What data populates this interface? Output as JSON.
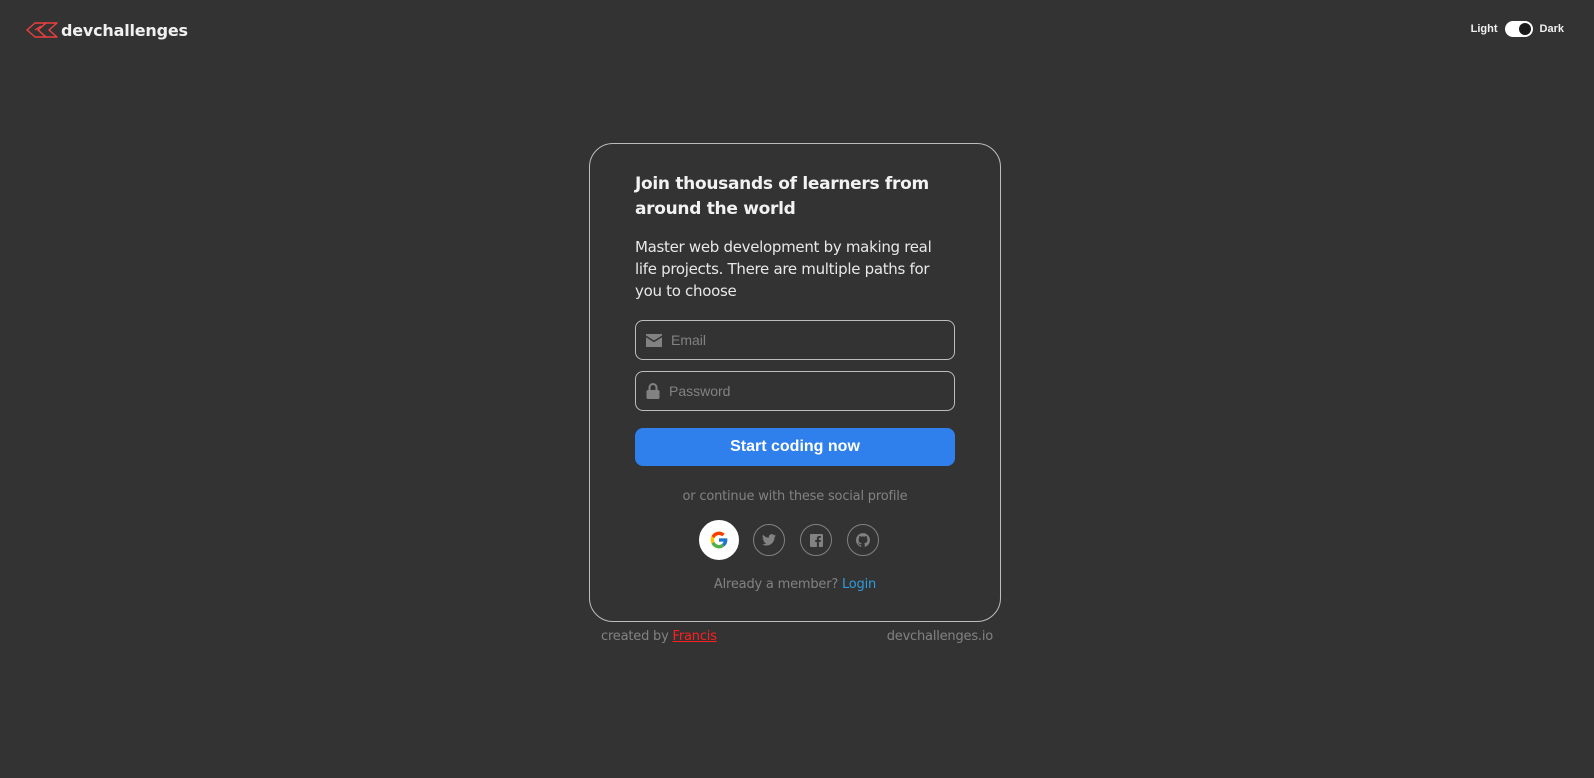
{
  "header": {
    "brand_name": "devchallenges",
    "logo_icon": "devchallenges-logo-icon",
    "theme": {
      "light_label": "Light",
      "dark_label": "Dark",
      "state": "dark"
    }
  },
  "card": {
    "headline": "Join thousands of learners from around the world",
    "subtitle": "Master web development by making real life projects. There are multiple paths for you to choose",
    "email": {
      "icon": "mail-icon",
      "placeholder": "Email",
      "value": ""
    },
    "password": {
      "icon": "lock-icon",
      "placeholder": "Password",
      "value": ""
    },
    "submit_label": "Start coding now",
    "social_prompt": "or continue with these social profile",
    "socials": [
      {
        "name": "Google",
        "icon": "google-icon"
      },
      {
        "name": "Twitter",
        "icon": "twitter-icon"
      },
      {
        "name": "Facebook",
        "icon": "facebook-icon"
      },
      {
        "name": "GitHub",
        "icon": "github-icon"
      }
    ],
    "member_prompt": "Already a member?",
    "login_label": "Login"
  },
  "footer": {
    "created_by": "created by",
    "author": "Francis",
    "site": "devchallenges.io"
  },
  "colors": {
    "background": "#333333",
    "primary_button": "#2f80ed",
    "link": "#2d9cdb",
    "author_link": "#ff1f1f",
    "muted_text": "#828282",
    "border": "#bdbdbd"
  }
}
